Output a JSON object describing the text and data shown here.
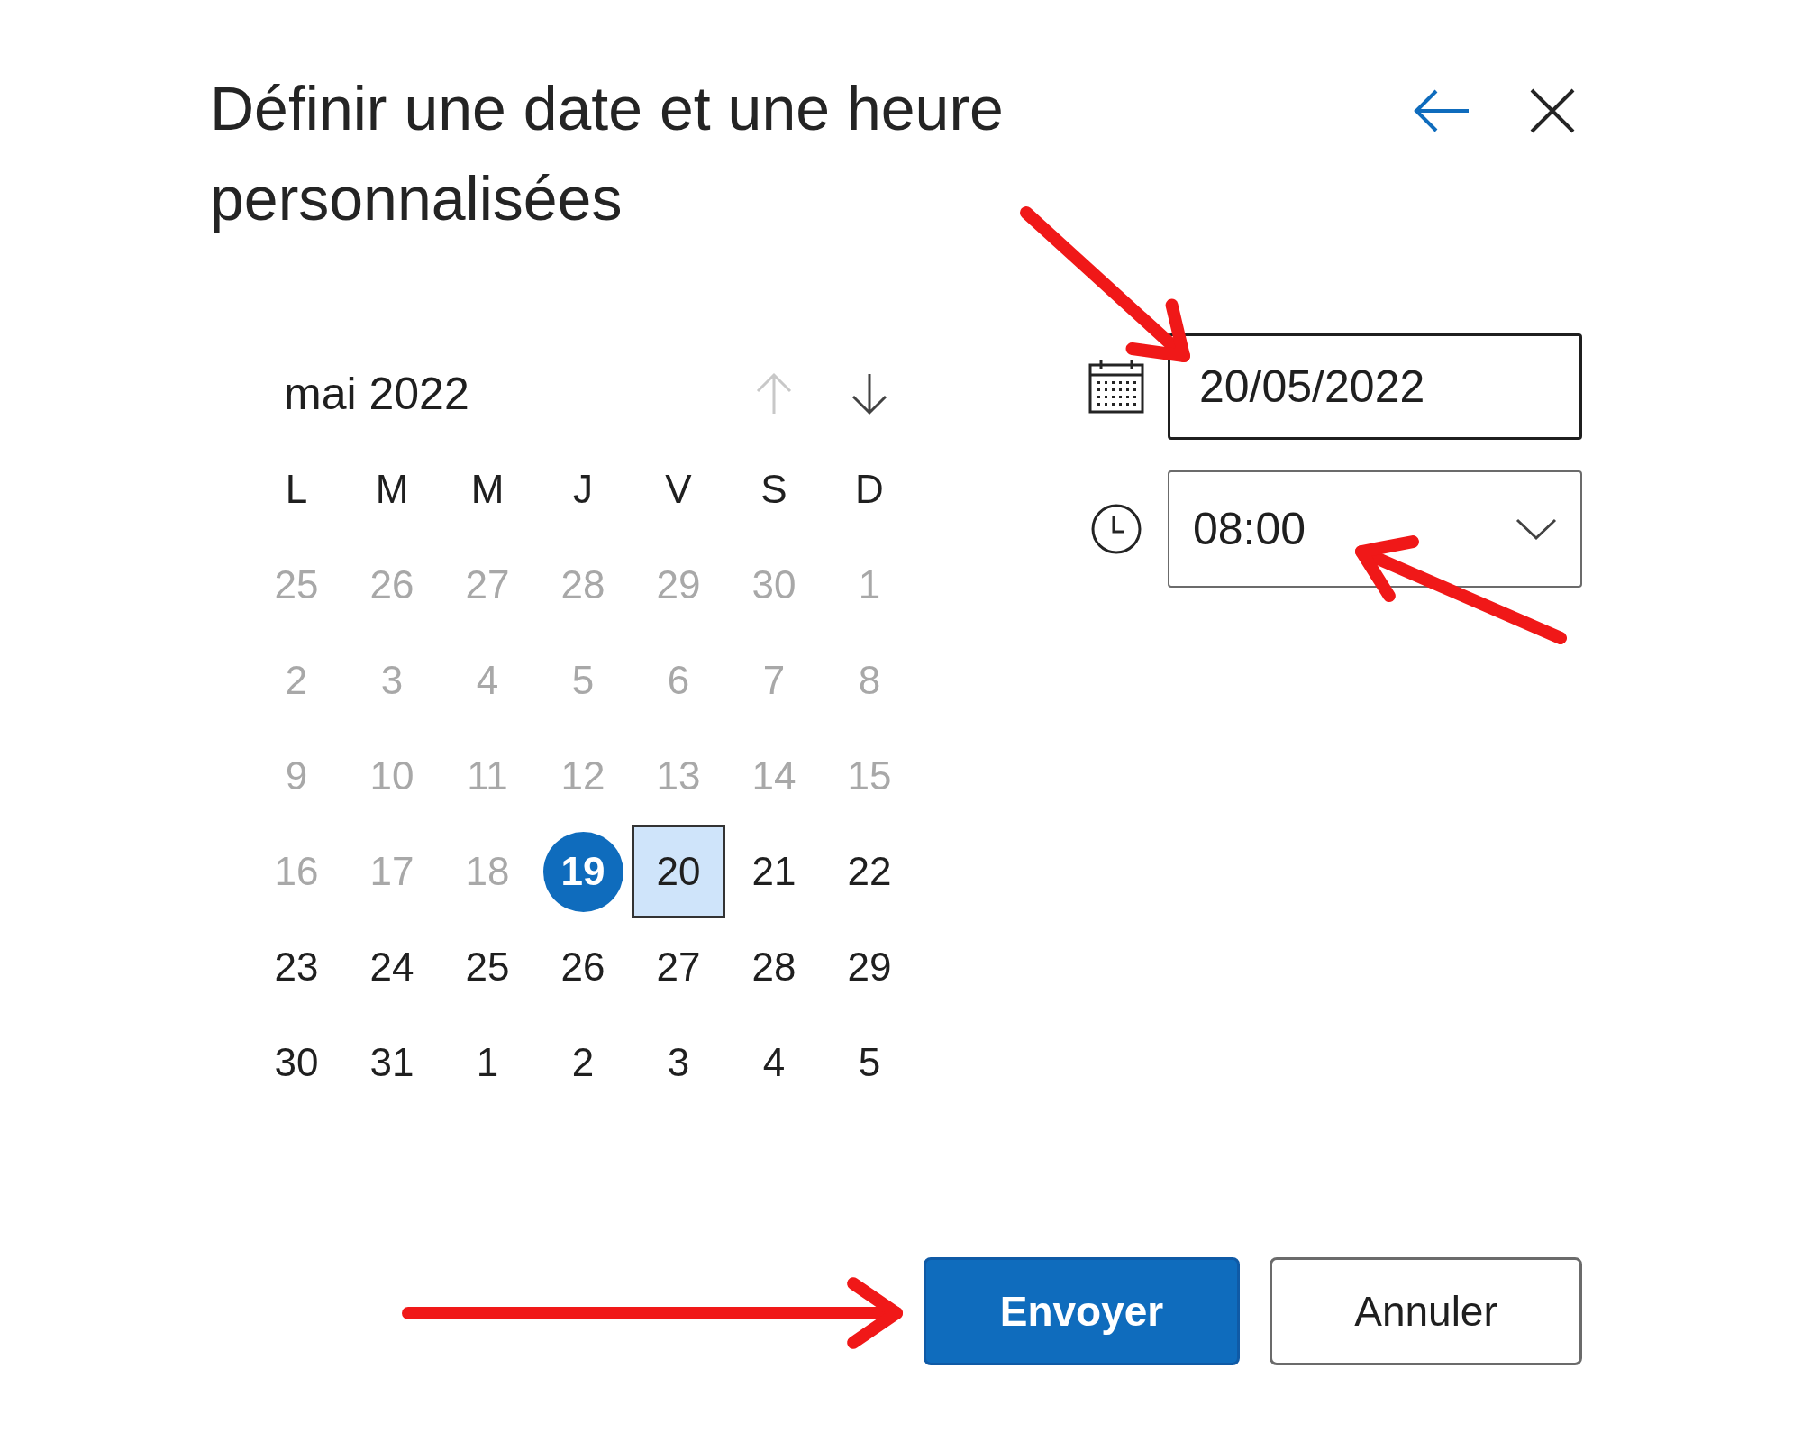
{
  "dialog": {
    "title": "Définir une date et une heure personnalisées",
    "back_button": {
      "kind": "back"
    },
    "close_button": {
      "kind": "close"
    }
  },
  "calendar": {
    "month_label": "mai 2022",
    "prev_button": {
      "disabled": true
    },
    "next_button": {
      "disabled": false
    },
    "weekdays": [
      "L",
      "M",
      "M",
      "J",
      "V",
      "S",
      "D"
    ],
    "days": [
      {
        "label": "25",
        "disabled": true,
        "today": false,
        "selected": false
      },
      {
        "label": "26",
        "disabled": true,
        "today": false,
        "selected": false
      },
      {
        "label": "27",
        "disabled": true,
        "today": false,
        "selected": false
      },
      {
        "label": "28",
        "disabled": true,
        "today": false,
        "selected": false
      },
      {
        "label": "29",
        "disabled": true,
        "today": false,
        "selected": false
      },
      {
        "label": "30",
        "disabled": true,
        "today": false,
        "selected": false
      },
      {
        "label": "1",
        "disabled": true,
        "today": false,
        "selected": false
      },
      {
        "label": "2",
        "disabled": true,
        "today": false,
        "selected": false
      },
      {
        "label": "3",
        "disabled": true,
        "today": false,
        "selected": false
      },
      {
        "label": "4",
        "disabled": true,
        "today": false,
        "selected": false
      },
      {
        "label": "5",
        "disabled": true,
        "today": false,
        "selected": false
      },
      {
        "label": "6",
        "disabled": true,
        "today": false,
        "selected": false
      },
      {
        "label": "7",
        "disabled": true,
        "today": false,
        "selected": false
      },
      {
        "label": "8",
        "disabled": true,
        "today": false,
        "selected": false
      },
      {
        "label": "9",
        "disabled": true,
        "today": false,
        "selected": false
      },
      {
        "label": "10",
        "disabled": true,
        "today": false,
        "selected": false
      },
      {
        "label": "11",
        "disabled": true,
        "today": false,
        "selected": false
      },
      {
        "label": "12",
        "disabled": true,
        "today": false,
        "selected": false
      },
      {
        "label": "13",
        "disabled": true,
        "today": false,
        "selected": false
      },
      {
        "label": "14",
        "disabled": true,
        "today": false,
        "selected": false
      },
      {
        "label": "15",
        "disabled": true,
        "today": false,
        "selected": false
      },
      {
        "label": "16",
        "disabled": true,
        "today": false,
        "selected": false
      },
      {
        "label": "17",
        "disabled": true,
        "today": false,
        "selected": false
      },
      {
        "label": "18",
        "disabled": true,
        "today": false,
        "selected": false
      },
      {
        "label": "19",
        "disabled": false,
        "today": true,
        "selected": false
      },
      {
        "label": "20",
        "disabled": false,
        "today": false,
        "selected": true
      },
      {
        "label": "21",
        "disabled": false,
        "today": false,
        "selected": false
      },
      {
        "label": "22",
        "disabled": false,
        "today": false,
        "selected": false
      },
      {
        "label": "23",
        "disabled": false,
        "today": false,
        "selected": false
      },
      {
        "label": "24",
        "disabled": false,
        "today": false,
        "selected": false
      },
      {
        "label": "25",
        "disabled": false,
        "today": false,
        "selected": false
      },
      {
        "label": "26",
        "disabled": false,
        "today": false,
        "selected": false
      },
      {
        "label": "27",
        "disabled": false,
        "today": false,
        "selected": false
      },
      {
        "label": "28",
        "disabled": false,
        "today": false,
        "selected": false
      },
      {
        "label": "29",
        "disabled": false,
        "today": false,
        "selected": false
      },
      {
        "label": "30",
        "disabled": false,
        "today": false,
        "selected": false
      },
      {
        "label": "31",
        "disabled": false,
        "today": false,
        "selected": false
      },
      {
        "label": "1",
        "disabled": false,
        "today": false,
        "selected": false
      },
      {
        "label": "2",
        "disabled": false,
        "today": false,
        "selected": false
      },
      {
        "label": "3",
        "disabled": false,
        "today": false,
        "selected": false
      },
      {
        "label": "4",
        "disabled": false,
        "today": false,
        "selected": false
      },
      {
        "label": "5",
        "disabled": false,
        "today": false,
        "selected": false
      }
    ]
  },
  "date_field": {
    "value": "20/05/2022"
  },
  "time_field": {
    "value": "08:00"
  },
  "buttons": [
    {
      "label": "Envoyer",
      "kind": "primary"
    },
    {
      "label": "Annuler",
      "kind": "secondary"
    }
  ],
  "annotation_arrows": [
    {
      "kind": "date"
    },
    {
      "kind": "time"
    },
    {
      "kind": "submit"
    }
  ]
}
